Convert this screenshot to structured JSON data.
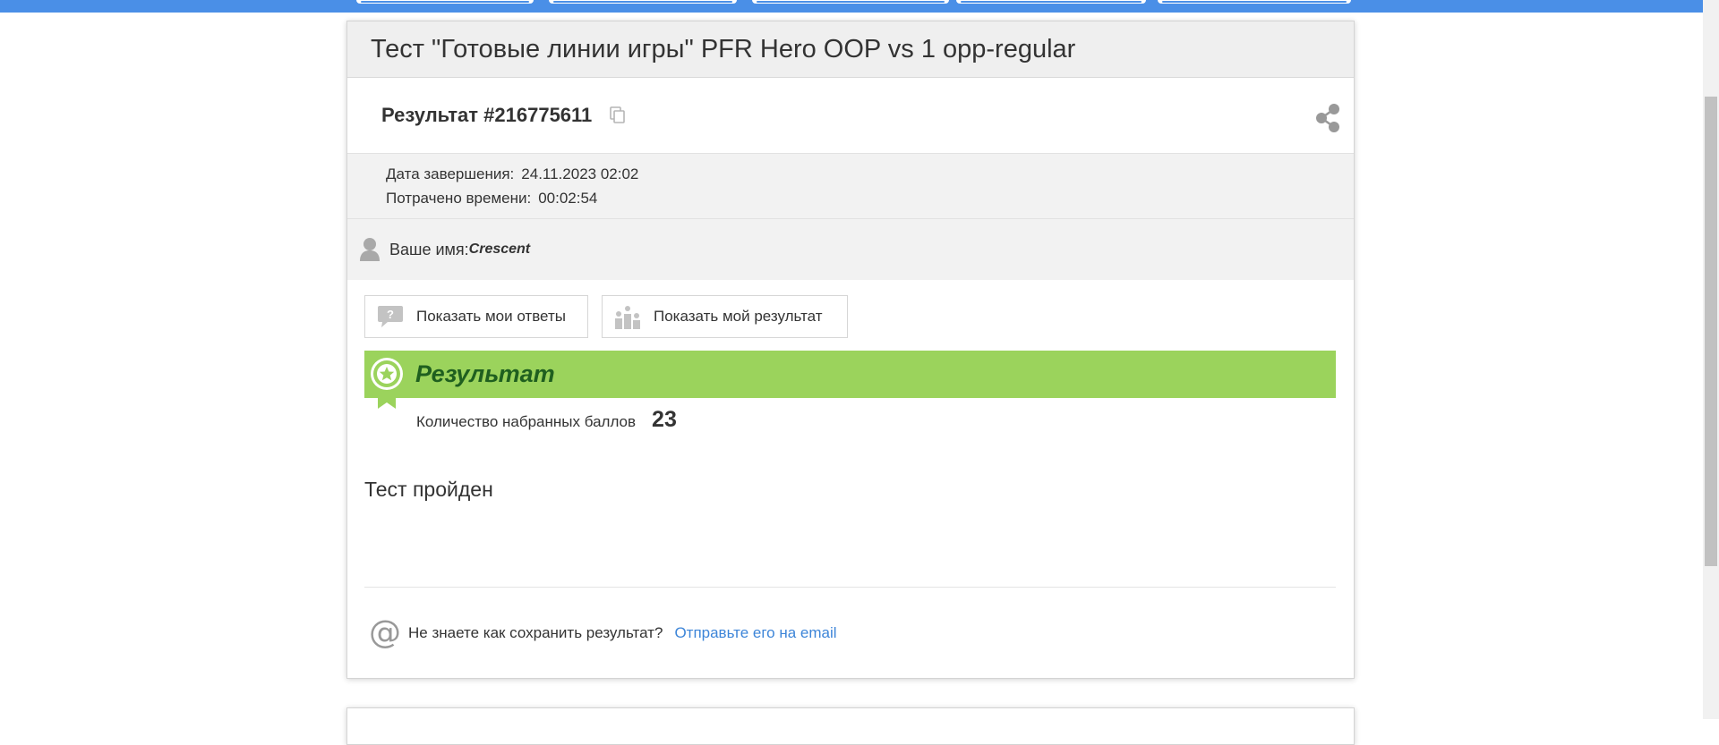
{
  "colors": {
    "topbar": "#4a8fe7",
    "banner": "#9bd35c",
    "banner_text": "#1f5f1f",
    "link": "#3d85d8"
  },
  "header": {
    "title": "Тест \"Готовые линии игры\" PFR Hero OOP vs 1 opp-regular"
  },
  "result": {
    "id_label": "Результат #216775611",
    "copy_icon": "copy-icon",
    "share_icon": "share-icon"
  },
  "meta": {
    "finish_label": "Дата завершения:",
    "finish_value": "24.11.2023 02:02",
    "time_label": "Потрачено времени:",
    "time_value": "00:02:54"
  },
  "user": {
    "label": "Ваше имя:",
    "name": "Crescent"
  },
  "buttons": {
    "show_answers": "Показать мои ответы",
    "show_result": "Показать мой результат"
  },
  "banner": {
    "title": "Результат"
  },
  "score": {
    "label": "Количество набранных баллов",
    "value": "23"
  },
  "status": {
    "text": "Тест пройден"
  },
  "email": {
    "question": "Не знаете как сохранить результат?",
    "link": "Отправьте его на email"
  }
}
